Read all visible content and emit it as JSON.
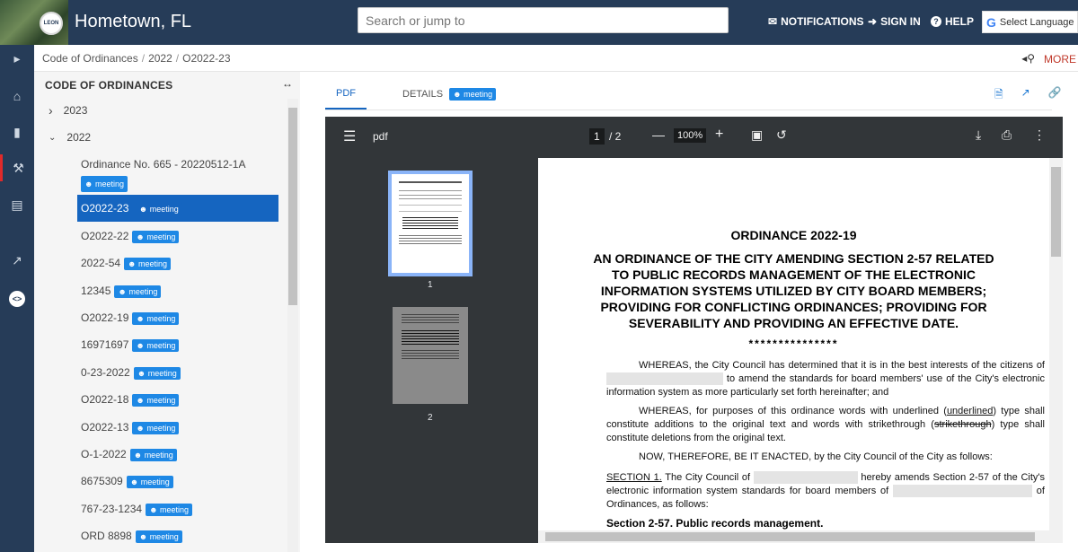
{
  "header": {
    "seal_text": "LEON",
    "site_title": "Hometown, FL",
    "search_placeholder": "Search or jump to",
    "notifications": "NOTIFICATIONS",
    "sign_in": "SIGN IN",
    "help": "HELP",
    "language": "Select Language"
  },
  "breadcrumb": {
    "items": [
      "Code of Ordinances",
      "2022",
      "O2022-23"
    ],
    "more": "MORE"
  },
  "sidebar": {
    "title": "CODE OF ORDINANCES",
    "years": [
      {
        "label": "2023",
        "expanded": false
      },
      {
        "label": "2022",
        "expanded": true
      }
    ],
    "items": [
      {
        "label": "Ordinance No. 665 - 20220512-1A",
        "badge": "meeting"
      },
      {
        "label": "O2022-23",
        "badge": "meeting"
      },
      {
        "label": "O2022-22",
        "badge": "meeting"
      },
      {
        "label": "2022-54",
        "badge": "meeting"
      },
      {
        "label": "12345",
        "badge": "meeting"
      },
      {
        "label": "O2022-19",
        "badge": "meeting"
      },
      {
        "label": "16971697",
        "badge": "meeting"
      },
      {
        "label": "0-23-2022",
        "badge": "meeting"
      },
      {
        "label": "O2022-18",
        "badge": "meeting"
      },
      {
        "label": "O2022-13",
        "badge": "meeting"
      },
      {
        "label": "O-1-2022",
        "badge": "meeting"
      },
      {
        "label": "8675309",
        "badge": "meeting"
      },
      {
        "label": "767-23-1234",
        "badge": "meeting"
      },
      {
        "label": "ORD 8898",
        "badge": "meeting"
      }
    ]
  },
  "tabs": {
    "pdf": "PDF",
    "details": "DETAILS",
    "details_badge": "meeting"
  },
  "viewer": {
    "name": "pdf",
    "page_current": "1",
    "page_total": "/ 2",
    "zoom": "100%",
    "thumb1_label": "1",
    "thumb2_label": "2"
  },
  "document": {
    "title": "ORDINANCE 2022-19",
    "subtitle_lines": [
      "AN ORDINANCE OF THE CITY AMENDING SECTION 2-57 RELATED",
      "TO PUBLIC RECORDS MANAGEMENT OF THE ELECTRONIC",
      "INFORMATION SYSTEMS UTILIZED BY CITY BOARD MEMBERS;",
      "PROVIDING FOR CONFLICTING ORDINANCES; PROVIDING FOR",
      "SEVERABILITY AND PROVIDING AN EFFECTIVE DATE."
    ],
    "stars": "***************",
    "whereas1_a": "WHEREAS, the City Council has determined that it is in the best interests of the citizens of",
    "whereas1_b": "to amend the standards for board members' use of the City's electronic information system as more particularly set forth hereinafter; and",
    "whereas2_a": "WHEREAS, for purposes of this ordinance words with underlined (",
    "whereas2_u": "underlined",
    "whereas2_b": ") type shall constitute additions to the original text and words with strikethrough (",
    "whereas2_s": "strikethrough",
    "whereas2_c": ") type shall constitute deletions from the original text.",
    "enacted": "NOW, THEREFORE, BE IT ENACTED, by the City Council of the City as follows:",
    "section1_label": "SECTION 1.",
    "section1_a": "The City Council of",
    "section1_b": "hereby amends Section 2-57 of the City's electronic information system standards for board members of",
    "section1_c": "of Ordinances, as follows:",
    "section_heading": "Section 2-57.  Public records management."
  }
}
